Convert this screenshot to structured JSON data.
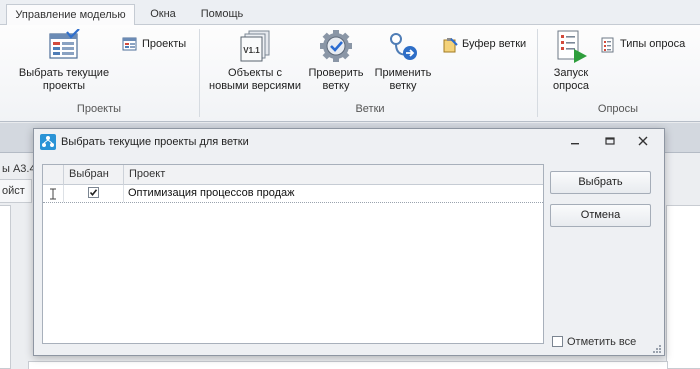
{
  "ribbon": {
    "tabs": [
      {
        "label": "Управление моделью",
        "active": true
      },
      {
        "label": "Окна",
        "active": false
      },
      {
        "label": "Помощь",
        "active": false
      }
    ],
    "groups": {
      "projects": "Проекты",
      "branches": "Ветки",
      "surveys": "Опросы"
    },
    "buttons": {
      "select_current_projects": "Выбрать текущие\nпроекты",
      "projects": "Проекты",
      "objects_new_versions": "Объекты с\nновыми версиями",
      "check_branch": "Проверить\nветку",
      "apply_branch": "Применить\nветку",
      "branch_buffer": "Буфер ветки",
      "start_survey": "Запуск\nопроса",
      "survey_types": "Типы опроса"
    },
    "version_badge": "V1.1"
  },
  "background": {
    "doc_text_1": "ы А3.4",
    "doc_text_2": "ойст"
  },
  "dialog": {
    "title": "Выбрать текущие проекты для ветки",
    "grid": {
      "columns": [
        "Выбран",
        "Проект"
      ],
      "rows": [
        {
          "selected": true,
          "project": "Оптимизация процессов продаж"
        }
      ]
    },
    "buttons": {
      "select": "Выбрать",
      "cancel": "Отмена"
    },
    "mark_all": {
      "label": "Отметить все",
      "checked": false
    }
  }
}
